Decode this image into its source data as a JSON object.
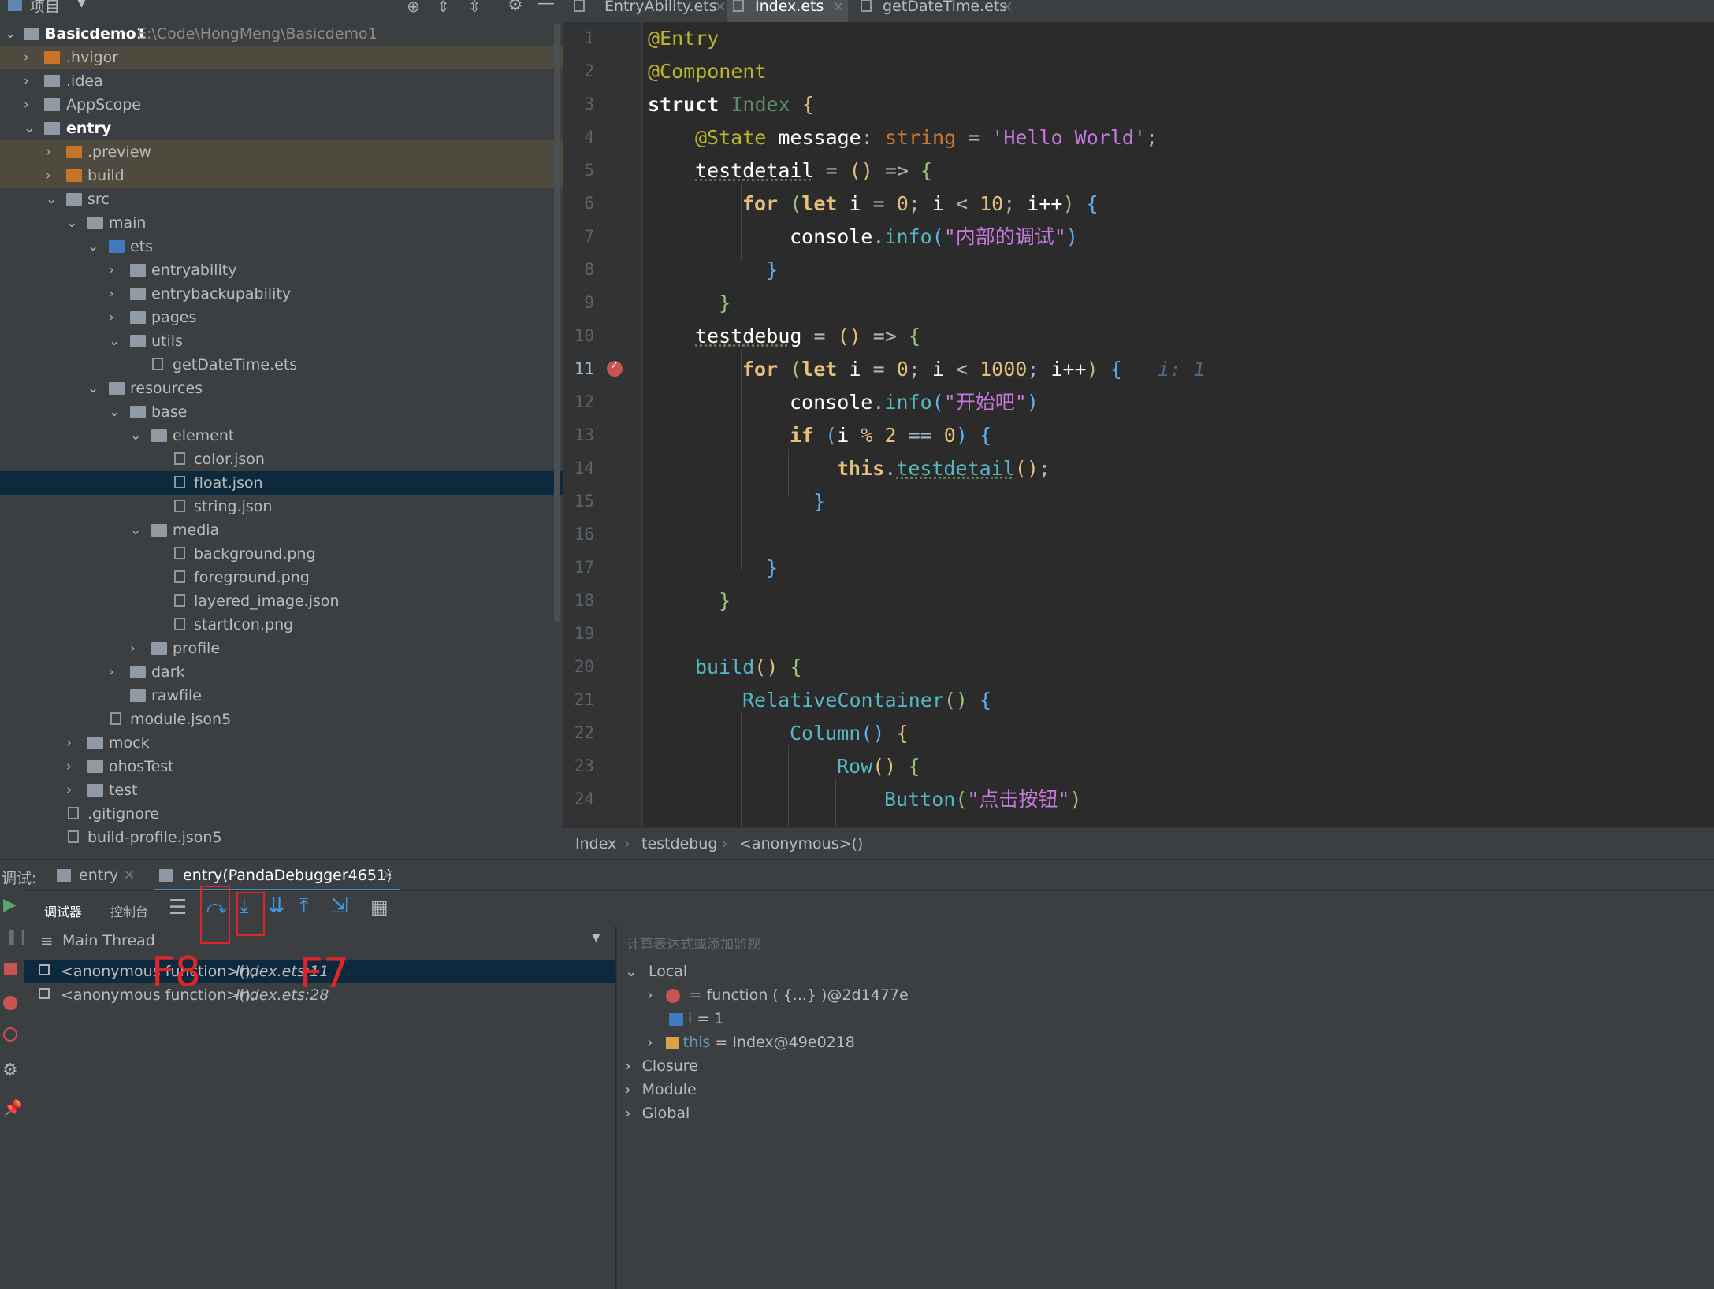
{
  "project": {
    "title": "项目",
    "root_name": "Basicdemo1",
    "root_path": "E:\\Code\\HongMeng\\Basicdemo1",
    "items": [
      {
        "label": ".hvigor"
      },
      {
        "label": ".idea"
      },
      {
        "label": "AppScope"
      },
      {
        "label": "entry"
      },
      {
        "label": ".preview"
      },
      {
        "label": "build"
      },
      {
        "label": "src"
      },
      {
        "label": "main"
      },
      {
        "label": "ets"
      },
      {
        "label": "entryability"
      },
      {
        "label": "entrybackupability"
      },
      {
        "label": "pages"
      },
      {
        "label": "utils"
      },
      {
        "label": "getDateTime.ets"
      },
      {
        "label": "resources"
      },
      {
        "label": "base"
      },
      {
        "label": "element"
      },
      {
        "label": "color.json"
      },
      {
        "label": "float.json"
      },
      {
        "label": "string.json"
      },
      {
        "label": "media"
      },
      {
        "label": "background.png"
      },
      {
        "label": "foreground.png"
      },
      {
        "label": "layered_image.json"
      },
      {
        "label": "startIcon.png"
      },
      {
        "label": "profile"
      },
      {
        "label": "dark"
      },
      {
        "label": "rawfile"
      },
      {
        "label": "module.json5"
      },
      {
        "label": "mock"
      },
      {
        "label": "ohosTest"
      },
      {
        "label": "test"
      },
      {
        "label": ".gitignore"
      },
      {
        "label": "build-profile.json5"
      }
    ]
  },
  "editor": {
    "tabs": [
      {
        "label": "EntryAbility.ets"
      },
      {
        "label": "Index.ets"
      },
      {
        "label": "getDateTime.ets"
      }
    ],
    "line_numbers": [
      "1",
      "2",
      "3",
      "4",
      "5",
      "6",
      "7",
      "8",
      "9",
      "10",
      "11",
      "12",
      "13",
      "14",
      "15",
      "16",
      "17",
      "18",
      "19",
      "20",
      "21",
      "22",
      "23",
      "24"
    ],
    "inline_value": "i: 1",
    "breadcrumb": [
      "Index",
      "testdebug",
      "<anonymous>()"
    ]
  },
  "debug": {
    "label": "调试:",
    "sessions": [
      {
        "label": "entry"
      },
      {
        "label": "entry(PandaDebugger4651)"
      }
    ],
    "tabs": {
      "debugger": "调试器",
      "console": "控制台"
    },
    "thread": "Main Thread",
    "frames": [
      {
        "name": "<anonymous function>(), ",
        "loc": "Index.ets:11"
      },
      {
        "name": "<anonymous function>(), ",
        "loc": "Index.ets:28"
      }
    ],
    "watch_placeholder": "计算表达式或添加监视",
    "variables": {
      "local": "Local",
      "fn_value": "= function ( {...} )@2d1477e",
      "i_name": "i",
      "i_value": " = 1",
      "this_name": "this",
      "this_value": " = Index@49e0218",
      "closure": "Closure",
      "module": "Module",
      "global": "Global"
    },
    "annotations": {
      "f8": "F8",
      "f7": "F7"
    }
  }
}
